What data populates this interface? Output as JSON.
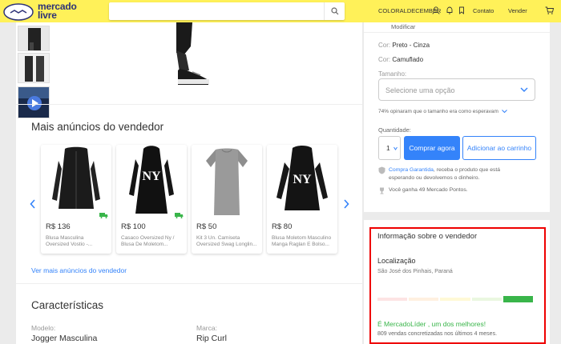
{
  "header": {
    "brand_line1": "mercado",
    "brand_line2": "livre",
    "search_placeholder": "",
    "username": "COLORALDECEMBER",
    "nav_contato": "Contato",
    "nav_vender": "Vender"
  },
  "product": {
    "modify_link": "Modificar",
    "color_label": "Cor:",
    "color_value": "Preto - Cinza",
    "color2_value": "Camuflado",
    "size_label": "Tamanho:",
    "size_placeholder": "Selecione uma opção",
    "size_opinion": "74% opinaram que o tamanho era como esperavam",
    "qty_label": "Quantidade:",
    "qty_value": "1",
    "buy_label": "Comprar agora",
    "cart_label": "Adicionar ao carrinho",
    "guarantee_link": "Compra Garantida",
    "guarantee_text": ", receba o produto que está",
    "guarantee_text2": "esperando ou devolvemos o dinheiro.",
    "points_text": "Você ganha 49 Mercado Pontos."
  },
  "seller_ads": {
    "title": "Mais anúncios do vendedor",
    "see_more": "Ver mais anúncios do vendedor",
    "items": [
      {
        "price": "R$ 136",
        "title1": "Blusa Masculina",
        "title2": "Oversized Vostio -..."
      },
      {
        "price": "R$ 100",
        "title1": "Casaco Oversized Ny /",
        "title2": "Blusa De Moletom..."
      },
      {
        "price": "R$ 50",
        "title1": "Kit 3 Un. Camiseta",
        "title2": "Oversized Swag Longlin..."
      },
      {
        "price": "R$ 80",
        "title1": "Blusa Moletom Masculino",
        "title2": "Manga Raglan E Bolso..."
      }
    ]
  },
  "characteristics": {
    "title": "Características",
    "model_label": "Modelo:",
    "model_value": "Jogger Masculina",
    "brand_label": "Marca:",
    "brand_value": "Rip Curl"
  },
  "seller": {
    "title": "Informação sobre o vendedor",
    "location_label": "Localização",
    "location_value": "São José dos Pinhais, Paraná",
    "leader_text": "É MercadoLíder , um dos melhores!",
    "sales_text": "809 vendas concretizadas nos últimos 4 meses."
  },
  "colors": {
    "header_bg": "#fff159",
    "accent": "#3483fa",
    "leader_green": "#39b54a",
    "highlight_border": "#ee0000"
  }
}
